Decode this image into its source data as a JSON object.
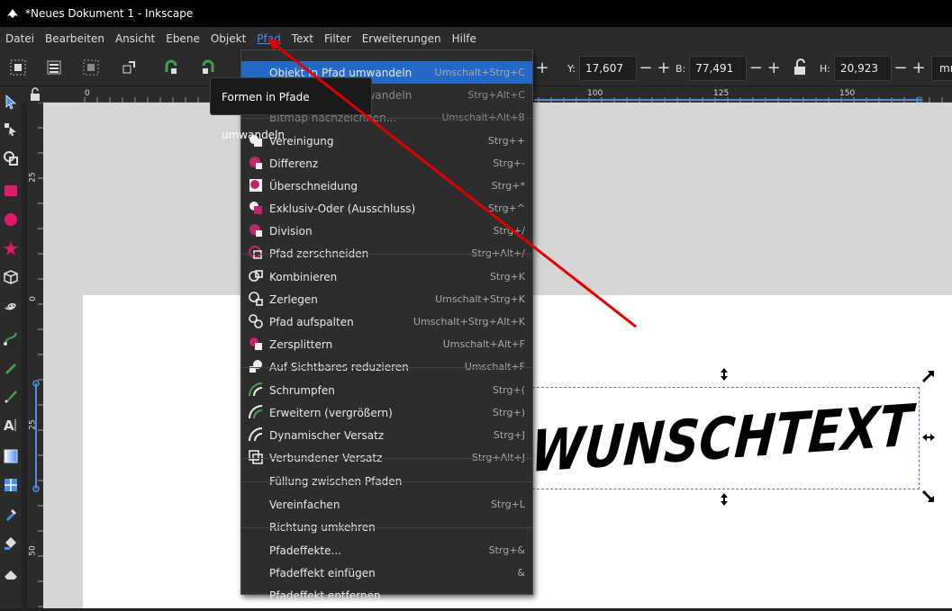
{
  "window": {
    "title": "*Neues Dokument 1 - Inkscape"
  },
  "menubar": {
    "items": [
      {
        "label": "Datei"
      },
      {
        "label": "Bearbeiten"
      },
      {
        "label": "Ansicht"
      },
      {
        "label": "Ebene"
      },
      {
        "label": "Objekt"
      },
      {
        "label": "Pfad"
      },
      {
        "label": "Text"
      },
      {
        "label": "Filter"
      },
      {
        "label": "Erweiterungen"
      },
      {
        "label": "Hilfe"
      }
    ]
  },
  "toolbar": {
    "y_label": "Y:",
    "y_value": "17,607",
    "b_label": "B:",
    "b_value": "77,491",
    "h_label": "H:",
    "h_value": "20,923",
    "unit": "mm",
    "minus": "−",
    "plus": "+"
  },
  "tooltip": {
    "text": "Formen in Pfade umwandeln"
  },
  "pfad_menu": {
    "items": [
      {
        "label": "Objekt in Pfad umwandeln",
        "shortcut": "Umschalt+Strg+C"
      },
      {
        "label": "Kontur in Pfad umwandeln",
        "shortcut": "Strg+Alt+C"
      },
      {
        "label": "Bitmap nachzeichnen...",
        "shortcut": "Umschalt+Alt+B"
      },
      {
        "label": "Vereinigung",
        "shortcut": "Strg++"
      },
      {
        "label": "Differenz",
        "shortcut": "Strg+-"
      },
      {
        "label": "Überschneidung",
        "shortcut": "Strg+*"
      },
      {
        "label": "Exklusiv-Oder (Ausschluss)",
        "shortcut": "Strg+^"
      },
      {
        "label": "Division",
        "shortcut": "Strg+/"
      },
      {
        "label": "Pfad zerschneiden",
        "shortcut": "Strg+Alt+/"
      },
      {
        "label": "Kombinieren",
        "shortcut": "Strg+K"
      },
      {
        "label": "Zerlegen",
        "shortcut": "Umschalt+Strg+K"
      },
      {
        "label": "Pfad aufspalten",
        "shortcut": "Umschalt+Strg+Alt+K"
      },
      {
        "label": "Zersplittern",
        "shortcut": "Umschalt+Alt+F"
      },
      {
        "label": "Auf Sichtbares reduzieren",
        "shortcut": "Umschalt+F"
      },
      {
        "label": "Schrumpfen",
        "shortcut": "Strg+("
      },
      {
        "label": "Erweitern (vergrößern)",
        "shortcut": "Strg+)"
      },
      {
        "label": "Dynamischer Versatz",
        "shortcut": "Strg+J"
      },
      {
        "label": "Verbundener Versatz",
        "shortcut": "Strg+Alt+J"
      },
      {
        "label": "Füllung zwischen Pfaden",
        "shortcut": ""
      },
      {
        "label": "Vereinfachen",
        "shortcut": "Strg+L"
      },
      {
        "label": "Richtung umkehren",
        "shortcut": ""
      },
      {
        "label": "Pfadeffekte...",
        "shortcut": "Strg+&"
      },
      {
        "label": "Pfadeffekt einfügen",
        "shortcut": "&"
      },
      {
        "label": "Pfadeffekt entfernen",
        "shortcut": ""
      }
    ]
  },
  "ruler": {
    "top_labels": [
      "0",
      "100",
      "125",
      "150"
    ],
    "left_labels": [
      "25",
      "0",
      "25",
      "50"
    ]
  },
  "canvas": {
    "text": "WUNSCHTEXT"
  },
  "colors": {
    "accent": "#4a8ff0",
    "highlight": "#2569c7",
    "arrow": "#e00000",
    "boolean_icon": "#c0266e"
  }
}
